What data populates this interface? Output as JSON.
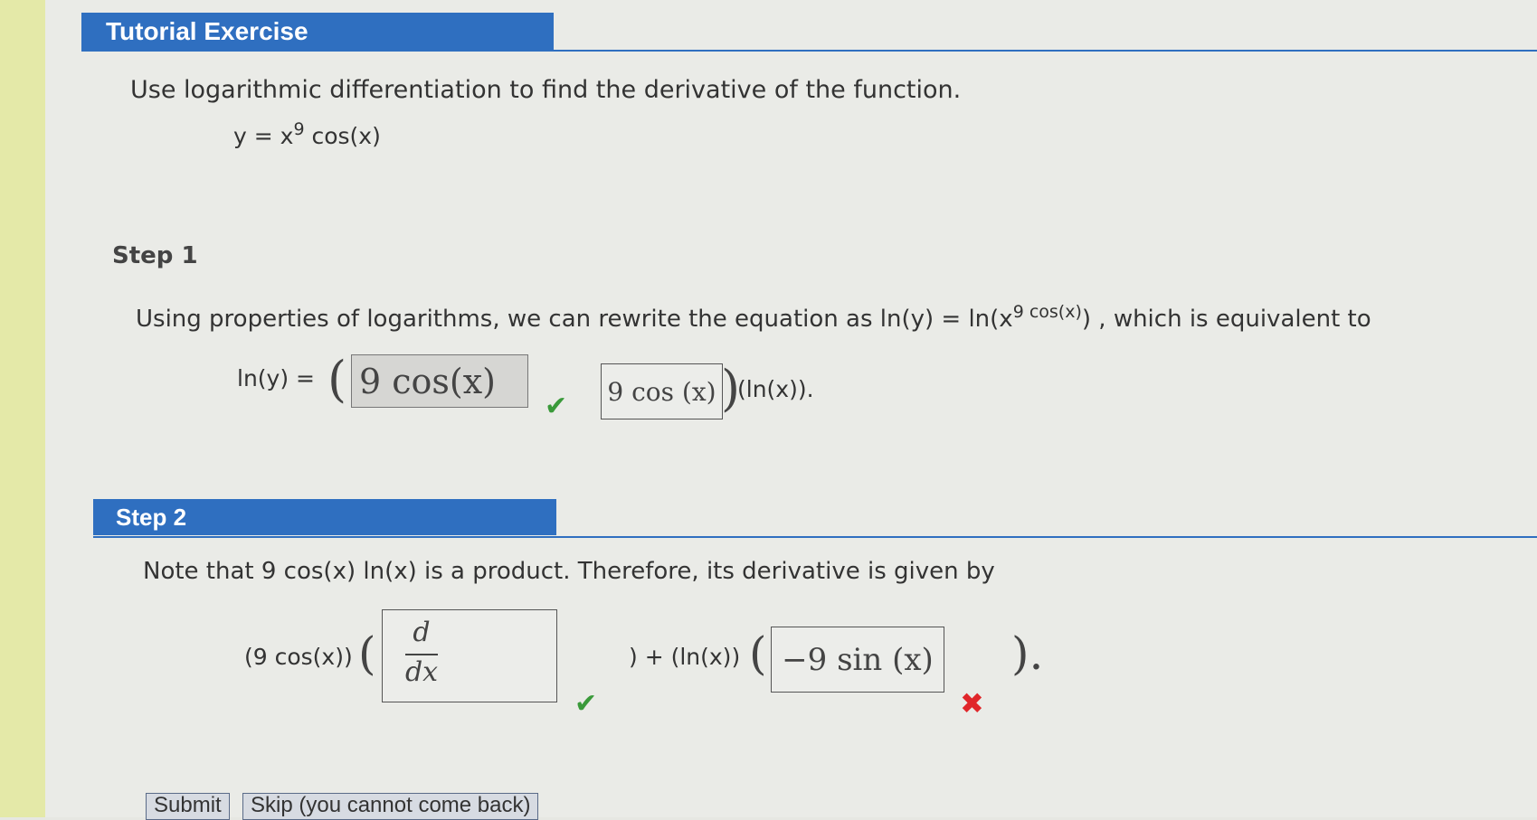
{
  "header": {
    "title": "Tutorial Exercise"
  },
  "problem": {
    "instruction": "Use logarithmic differentiation to find the derivative of the function.",
    "function_lhs": "y = x",
    "function_exp": "9",
    "function_rhs": " cos(x)"
  },
  "step1": {
    "label": "Step 1",
    "sentence_prefix": "Using properties of logarithms, we can rewrite the equation as  ln(y) = ln(x",
    "sentence_exp": "9 cos(x)",
    "sentence_suffix": ") , which is equivalent to",
    "eq_lhs": "ln(y) = ",
    "answer_filled": "9 cos(x)",
    "answer_current": "9 cos (x)",
    "eq_tail": "(ln(x))."
  },
  "step2": {
    "label": "Step 2",
    "sentence": "Note that  9 cos(x) ln(x)  is a product. Therefore, its derivative is given by",
    "term1_prefix": "(9 cos(x))",
    "frac_num": "d",
    "frac_den": "dx",
    "plus_term": ") + (ln(x))",
    "answer_2": "−9 sin (x)",
    "close": ")."
  },
  "marks": {
    "check": "✔",
    "cross": "✖"
  },
  "buttons": {
    "submit": "Submit",
    "skip": "Skip (you cannot come back)"
  },
  "colors": {
    "accent": "#2f6fc0",
    "correct": "#3a9a3a",
    "incorrect": "#e0262a"
  }
}
